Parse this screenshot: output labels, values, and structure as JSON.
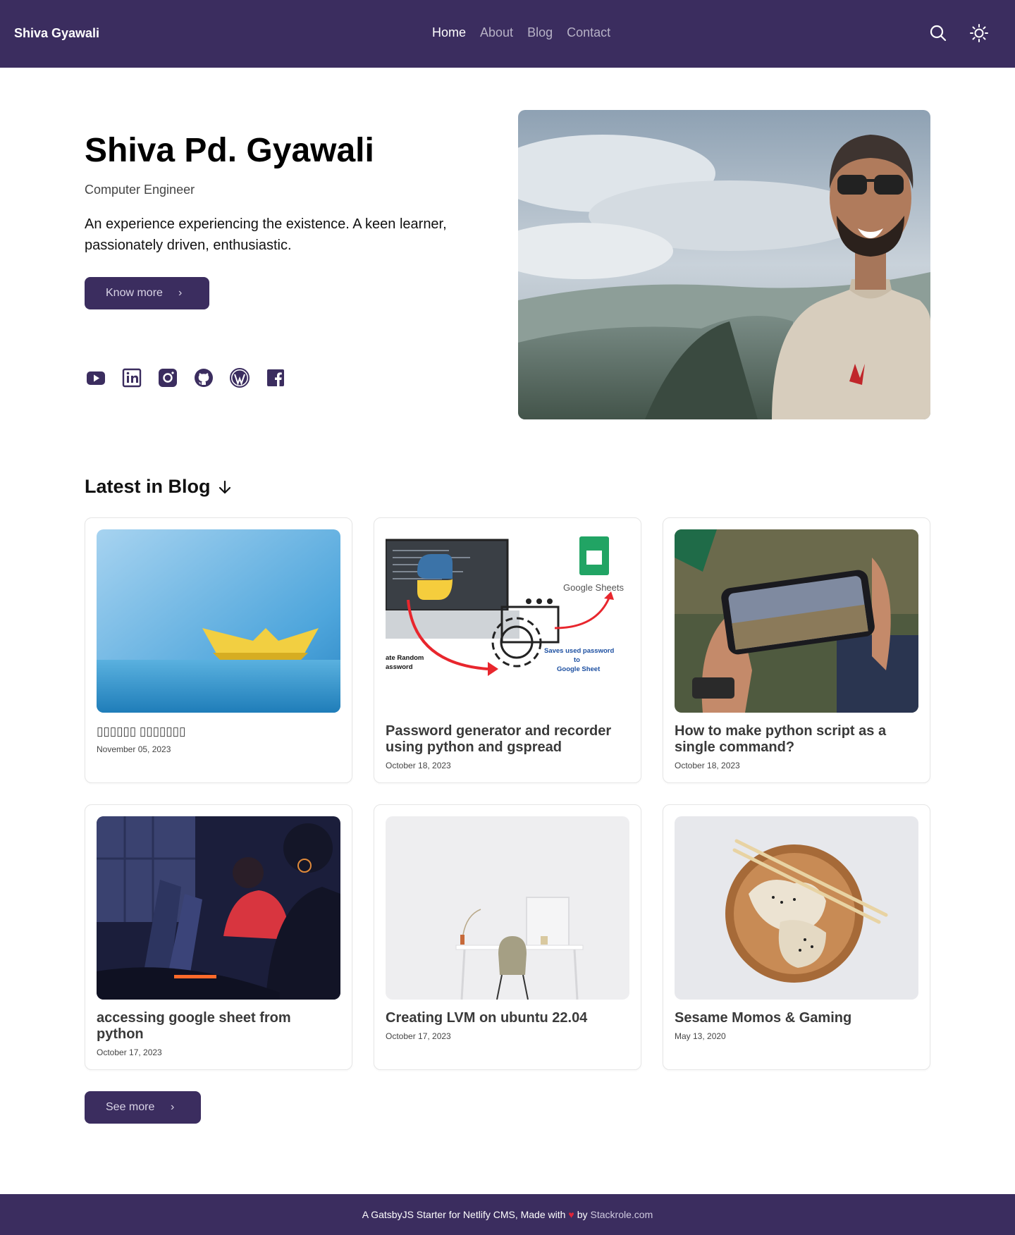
{
  "header": {
    "brand": "Shiva Gyawali",
    "nav": [
      "Home",
      "About",
      "Blog",
      "Contact"
    ],
    "active_nav": "Home",
    "icons": [
      "search-icon",
      "sun-icon"
    ]
  },
  "hero": {
    "name": "Shiva Pd. Gyawali",
    "role": "Computer Engineer",
    "description": "An experience experiencing the existence. A keen learner, passionately driven, enthusiastic.",
    "button_label": "Know more",
    "socials": [
      "youtube-icon",
      "linkedin-icon",
      "instagram-icon",
      "github-icon",
      "wordpress-icon",
      "facebook-icon"
    ]
  },
  "blog": {
    "heading": "Latest in Blog",
    "posts": [
      {
        "title": "▯▯▯▯▯▯ ▯▯▯▯▯▯▯",
        "date": "November 05, 2023"
      },
      {
        "title": "Password generator and recorder using python and gspread",
        "date": "October 18, 2023"
      },
      {
        "title": "How to make python script as a single command?",
        "date": "October 18, 2023"
      },
      {
        "title": "accessing google sheet from python",
        "date": "October 17, 2023"
      },
      {
        "title": "Creating LVM on ubuntu 22.04",
        "date": "October 17, 2023"
      },
      {
        "title": "Sesame Momos & Gaming",
        "date": "May 13, 2020"
      }
    ],
    "thumb_texts": {
      "google_sheets": "Google Sheets",
      "saves_line1": "Saves used password",
      "saves_line2": "to",
      "saves_line3": "Google Sheet",
      "random_line1": "ate Random",
      "random_line2": "assword"
    },
    "see_more_label": "See more"
  },
  "footer": {
    "text_before": "A GatsbyJS Starter for Netlify CMS, Made with",
    "heart": "♥",
    "text_by": "by",
    "link": "Stackrole.com"
  },
  "colors": {
    "primary": "#3b2d5f",
    "heart": "#e0243a"
  }
}
